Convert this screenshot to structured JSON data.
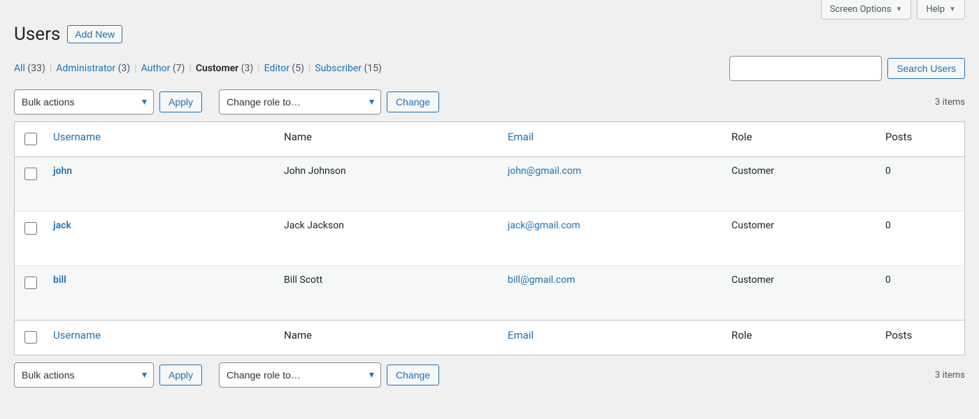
{
  "topTabs": {
    "screenOptions": "Screen Options",
    "help": "Help"
  },
  "page": {
    "title": "Users",
    "addNew": "Add New"
  },
  "roleFilters": [
    {
      "key": "all",
      "label": "All",
      "count": "(33)",
      "current": false
    },
    {
      "key": "administrator",
      "label": "Administrator",
      "count": "(3)",
      "current": false
    },
    {
      "key": "author",
      "label": "Author",
      "count": "(7)",
      "current": false
    },
    {
      "key": "customer",
      "label": "Customer",
      "count": "(3)",
      "current": true
    },
    {
      "key": "editor",
      "label": "Editor",
      "count": "(5)",
      "current": false
    },
    {
      "key": "subscriber",
      "label": "Subscriber",
      "count": "(15)",
      "current": false
    }
  ],
  "search": {
    "buttonLabel": "Search Users",
    "value": ""
  },
  "bulk": {
    "selected": "Bulk actions",
    "apply": "Apply"
  },
  "changeRole": {
    "selected": "Change role to…",
    "button": "Change"
  },
  "itemsCount": "3 items",
  "columns": {
    "username": "Username",
    "name": "Name",
    "email": "Email",
    "role": "Role",
    "posts": "Posts"
  },
  "rows": [
    {
      "username": "john",
      "name": "John Johnson",
      "email": "john@gmail.com",
      "role": "Customer",
      "posts": "0"
    },
    {
      "username": "jack",
      "name": "Jack Jackson",
      "email": "jack@gmail.com",
      "role": "Customer",
      "posts": "0"
    },
    {
      "username": "bill",
      "name": "Bill Scott",
      "email": "bill@gmail.com",
      "role": "Customer",
      "posts": "0"
    }
  ]
}
